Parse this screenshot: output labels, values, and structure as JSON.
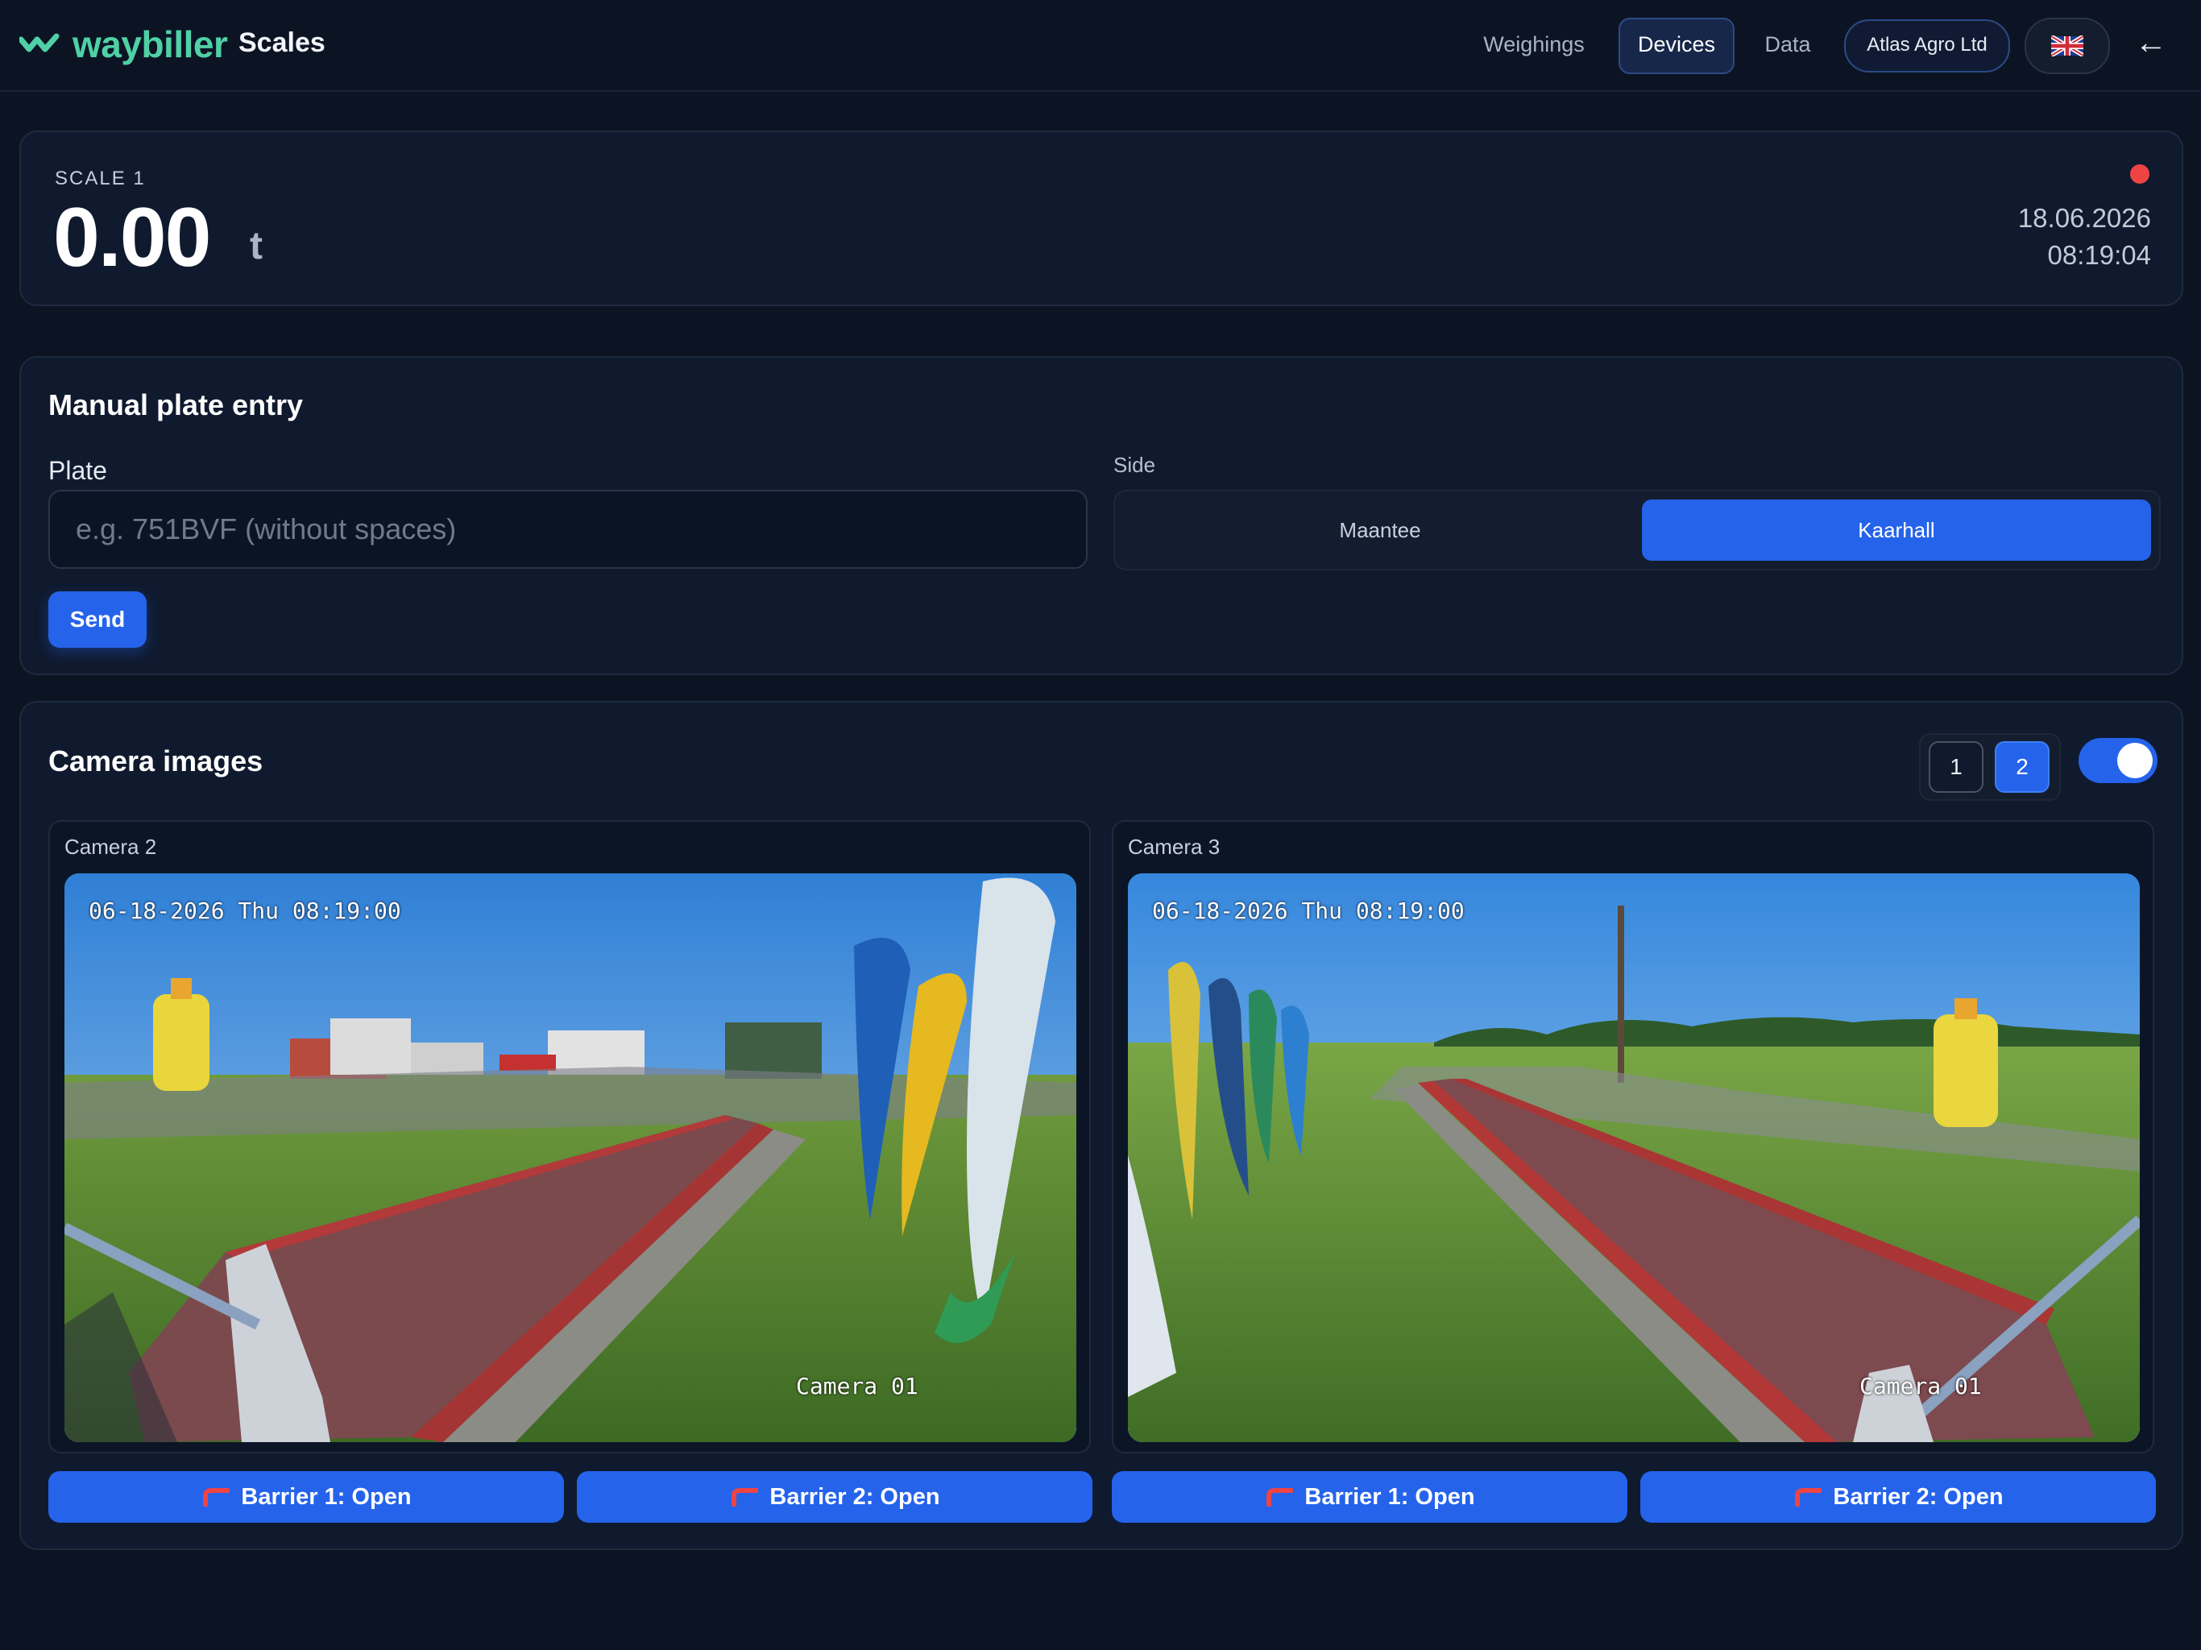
{
  "header": {
    "logo_text": "waybiller",
    "app_name": "Scales",
    "nav": {
      "weighings": "Weighings",
      "devices": "Devices",
      "data": "Data"
    },
    "organization": "Atlas Agro Ltd",
    "language_icon": "uk-flag-icon",
    "back_icon": "←"
  },
  "scale": {
    "label": "SCALE 1",
    "value": "0.00",
    "unit": "t",
    "status_color": "#ef4444",
    "date": "18.06.2026",
    "time": "08:19:04"
  },
  "manual_entry": {
    "title": "Manual plate entry",
    "plate_label": "Plate",
    "plate_value": "",
    "plate_placeholder": "e.g. 751BVF (without spaces)",
    "send_label": "Send",
    "side_label": "Side",
    "side_options": [
      "Maantee",
      "Kaarhall"
    ],
    "side_selected": "Kaarhall"
  },
  "camera_images": {
    "title": "Camera images",
    "count_options": [
      "1",
      "2"
    ],
    "count_selected": "2",
    "toggle_on": true,
    "cameras": [
      {
        "label": "Camera 2",
        "timestamp": "06-18-2026 Thu 08:19:00",
        "overlay_name": "Camera 01"
      },
      {
        "label": "Camera 3",
        "timestamp": "06-18-2026 Thu 08:19:00",
        "overlay_name": "Camera 01"
      }
    ],
    "barriers": [
      "Barrier 1: Open",
      "Barrier 2: Open",
      "Barrier 1: Open",
      "Barrier 2: Open"
    ]
  },
  "colors": {
    "accent": "#2563eb",
    "brand": "#4fd1a5",
    "background": "#0c1424",
    "card": "#0f1a2e"
  }
}
